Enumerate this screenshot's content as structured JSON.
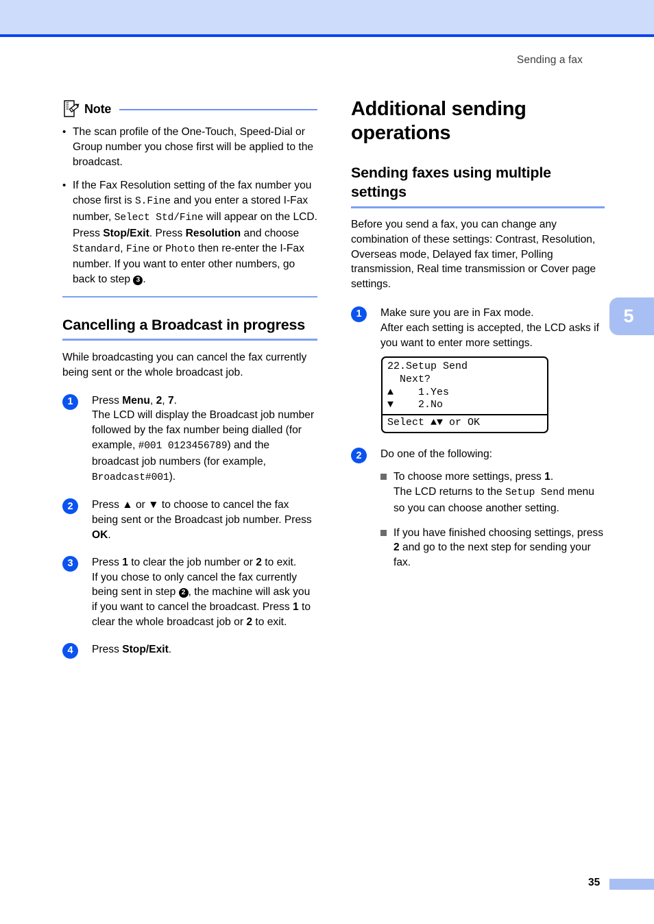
{
  "header": {
    "running_head": "Sending a fax"
  },
  "chapter_tab": {
    "number": "5"
  },
  "footer": {
    "page_number": "35"
  },
  "note": {
    "title": "Note",
    "icon": "note-pencil-icon",
    "items": [
      {
        "bullet": "•",
        "segments": [
          {
            "type": "text",
            "value": "The scan profile of the One-Touch, Speed-Dial or Group number you chose first will be applied to the broadcast."
          }
        ]
      },
      {
        "bullet": "•",
        "segments": [
          {
            "type": "text",
            "value": "If the Fax Resolution setting of the fax number you chose first is "
          },
          {
            "type": "mono",
            "value": "S.Fine"
          },
          {
            "type": "text",
            "value": " and you enter a stored I-Fax number, "
          },
          {
            "type": "mono",
            "value": "Select Std/Fine"
          },
          {
            "type": "text",
            "value": " will appear on the LCD. Press "
          },
          {
            "type": "bold",
            "value": "Stop/Exit"
          },
          {
            "type": "text",
            "value": ". Press "
          },
          {
            "type": "bold",
            "value": "Resolution"
          },
          {
            "type": "text",
            "value": " and choose "
          },
          {
            "type": "mono",
            "value": "Standard"
          },
          {
            "type": "text",
            "value": ", "
          },
          {
            "type": "mono",
            "value": "Fine"
          },
          {
            "type": "text",
            "value": " or "
          },
          {
            "type": "mono",
            "value": "Photo"
          },
          {
            "type": "text",
            "value": " then re-enter the I-Fax number. If you want to enter other numbers, go back to step "
          },
          {
            "type": "stepref",
            "value": "3"
          },
          {
            "type": "text",
            "value": "."
          }
        ]
      }
    ]
  },
  "left_section": {
    "heading": "Cancelling a Broadcast in progress",
    "intro": "While broadcasting you can cancel the fax currently being sent or the whole broadcast job.",
    "steps": [
      {
        "number": "1",
        "segments": [
          {
            "type": "text",
            "value": "Press "
          },
          {
            "type": "bold",
            "value": "Menu"
          },
          {
            "type": "text",
            "value": ", "
          },
          {
            "type": "bold",
            "value": "2"
          },
          {
            "type": "text",
            "value": ", "
          },
          {
            "type": "bold",
            "value": "7"
          },
          {
            "type": "text",
            "value": ".\nThe LCD will display the Broadcast job number followed by the fax number being dialled (for example, "
          },
          {
            "type": "mono",
            "value": "#001 0123456789"
          },
          {
            "type": "text",
            "value": ") and the broadcast job numbers (for example, "
          },
          {
            "type": "mono",
            "value": "Broadcast#001"
          },
          {
            "type": "text",
            "value": ")."
          }
        ]
      },
      {
        "number": "2",
        "segments": [
          {
            "type": "text",
            "value": "Press ▲ or ▼ to choose to cancel the fax being sent or the Broadcast job number. Press "
          },
          {
            "type": "bold",
            "value": "OK"
          },
          {
            "type": "text",
            "value": "."
          }
        ]
      },
      {
        "number": "3",
        "segments": [
          {
            "type": "text",
            "value": "Press "
          },
          {
            "type": "bold",
            "value": "1"
          },
          {
            "type": "text",
            "value": " to clear the job number or "
          },
          {
            "type": "bold",
            "value": "2"
          },
          {
            "type": "text",
            "value": " to exit.\nIf you chose to only cancel the fax currently being sent in step "
          },
          {
            "type": "stepref",
            "value": "2"
          },
          {
            "type": "text",
            "value": ", the machine will ask you if you want to cancel the broadcast. Press "
          },
          {
            "type": "bold",
            "value": "1"
          },
          {
            "type": "text",
            "value": " to clear the whole broadcast job or "
          },
          {
            "type": "bold",
            "value": "2"
          },
          {
            "type": "text",
            "value": " to exit."
          }
        ]
      },
      {
        "number": "4",
        "segments": [
          {
            "type": "text",
            "value": "Press "
          },
          {
            "type": "bold",
            "value": "Stop/Exit"
          },
          {
            "type": "text",
            "value": "."
          }
        ]
      }
    ]
  },
  "right_section": {
    "h1": "Additional sending operations",
    "h2": "Sending faxes using multiple settings",
    "intro": "Before you send a fax, you can change any combination of these settings: Contrast, Resolution, Overseas mode, Delayed fax timer, Polling transmission, Real time transmission or Cover page settings.",
    "step1": {
      "number": "1",
      "text": "Make sure you are in Fax mode.\nAfter each setting is accepted, the LCD asks if you want to enter more settings."
    },
    "lcd": {
      "lines": [
        "22.Setup Send",
        "  Next?",
        "▲    1.Yes",
        "▼    2.No"
      ],
      "status": "Select ▲▼ or OK"
    },
    "step2": {
      "number": "2",
      "text": "Do one of the following:",
      "bullets": [
        {
          "segments": [
            {
              "type": "text",
              "value": "To choose more settings, press "
            },
            {
              "type": "bold",
              "value": "1"
            },
            {
              "type": "text",
              "value": ".\nThe LCD returns to the "
            },
            {
              "type": "mono",
              "value": "Setup Send"
            },
            {
              "type": "text",
              "value": " menu so you can choose another setting."
            }
          ]
        },
        {
          "segments": [
            {
              "type": "text",
              "value": "If you have finished choosing settings, press "
            },
            {
              "type": "bold",
              "value": "2"
            },
            {
              "type": "text",
              "value": " and go to the next step for sending your fax."
            }
          ]
        }
      ]
    }
  },
  "colors": {
    "header_band": "#cedcfb",
    "header_rule": "#0b46f0",
    "accent_rule": "#7e9ff2",
    "step_circle": "#0a53f0",
    "tab": "#a8bff4",
    "square_bullet": "#6b6b6b"
  }
}
